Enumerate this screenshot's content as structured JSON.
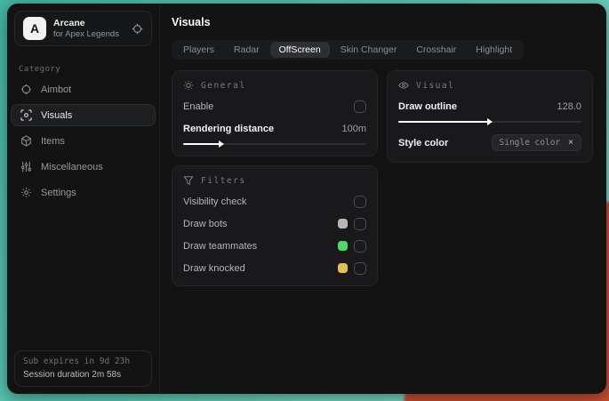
{
  "app": {
    "name": "Arcane",
    "subtitle": "for Apex Legends",
    "logo_letter": "A"
  },
  "sidebar": {
    "category_label": "Category",
    "items": [
      {
        "label": "Aimbot",
        "icon": "crosshair-icon",
        "active": false
      },
      {
        "label": "Visuals",
        "icon": "eye-scan-icon",
        "active": true
      },
      {
        "label": "Items",
        "icon": "box-icon",
        "active": false
      },
      {
        "label": "Miscellaneous",
        "icon": "sliders-icon",
        "active": false
      },
      {
        "label": "Settings",
        "icon": "gear-icon",
        "active": false
      }
    ],
    "footer": {
      "sub_expires": "Sub expires in 9d 23h",
      "session_duration": "Session duration 2m 58s"
    }
  },
  "main": {
    "title": "Visuals",
    "tabs": [
      {
        "label": "Players",
        "active": false
      },
      {
        "label": "Radar",
        "active": false
      },
      {
        "label": "OffScreen",
        "active": true
      },
      {
        "label": "Skin Changer",
        "active": false
      },
      {
        "label": "Crosshair",
        "active": false
      },
      {
        "label": "Highlight",
        "active": false
      }
    ],
    "panels": {
      "general": {
        "title": "General",
        "enable_label": "Enable",
        "enable_checked": false,
        "rendering_distance_label": "Rendering distance",
        "rendering_distance_value": "100m",
        "rendering_distance_fill": "20%"
      },
      "visual": {
        "title": "Visual",
        "draw_outline_label": "Draw outline",
        "draw_outline_value": "128.0",
        "draw_outline_fill": "49%",
        "style_color_label": "Style color",
        "style_color_value": "Single color",
        "style_color_clear": "×"
      },
      "filters": {
        "title": "Filters",
        "rows": [
          {
            "label": "Visibility check",
            "swatch": null,
            "checked": false
          },
          {
            "label": "Draw bots",
            "swatch": "#b5b5b5",
            "checked": false
          },
          {
            "label": "Draw teammates",
            "swatch": "#4cd964",
            "checked": false
          },
          {
            "label": "Draw knocked",
            "swatch": "#e0c253",
            "checked": false
          }
        ]
      }
    }
  },
  "colors": {
    "desktop_teal": "#5ac7b3",
    "desktop_red": "#c84e33",
    "window_bg": "#131314",
    "panel_bg": "#19191b",
    "active_pill": "#2e2f31",
    "slider_fill": "#ffffff"
  }
}
